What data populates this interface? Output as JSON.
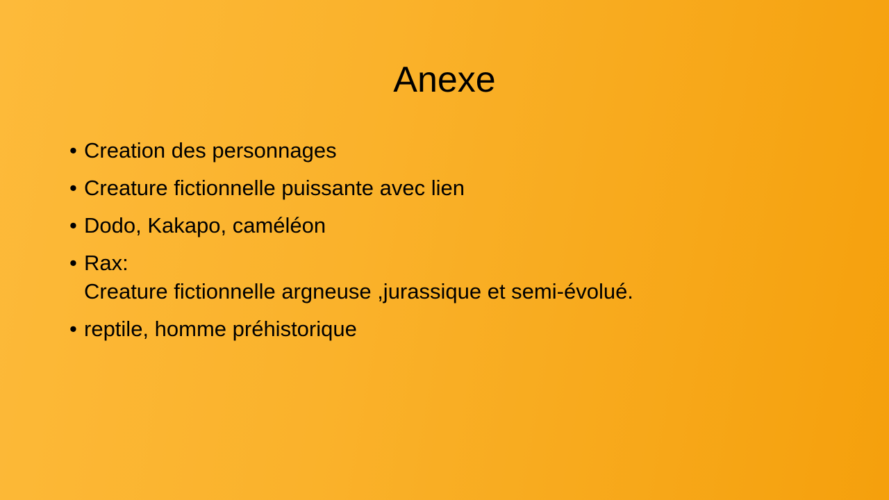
{
  "slide": {
    "title": "Anexe",
    "bullet_symbol": "•",
    "bullets": [
      {
        "lines": [
          "Creation des personnages"
        ]
      },
      {
        "lines": [
          "Creature fictionnelle puissante avec lien"
        ]
      },
      {
        "lines": [
          "Dodo, Kakapo, caméléon"
        ]
      },
      {
        "lines": [
          "Rax:",
          "Creature fictionnelle argneuse ,jurassique et semi-évolué."
        ]
      },
      {
        "lines": [
          "reptile, homme préhistorique"
        ]
      }
    ]
  },
  "colors": {
    "background_start": "#fdba3a",
    "background_end": "#f5a00c",
    "text": "#000000"
  }
}
